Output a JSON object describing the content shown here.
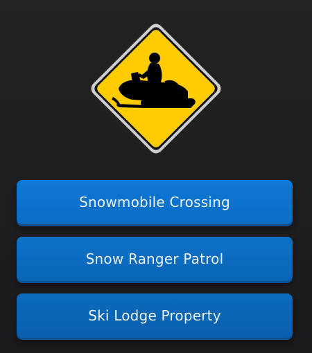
{
  "sign": {
    "icon": "snowmobile-icon",
    "background_color": "#FFCC00",
    "symbol_color": "#000000",
    "border_color": "#D0D0D0"
  },
  "answers": [
    {
      "label": "Snowmobile Crossing"
    },
    {
      "label": "Snow Ranger Patrol"
    },
    {
      "label": "Ski Lodge Property"
    }
  ],
  "colors": {
    "button": "#0A6CC4",
    "background": "#1F1F22"
  }
}
